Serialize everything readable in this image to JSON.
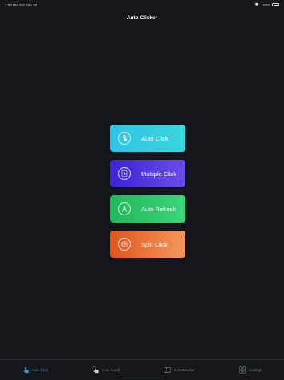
{
  "status_bar": {
    "time_date": "7:00 PM  Sat Feb 28",
    "battery_text": "100%"
  },
  "header": {
    "title": "Auto Clicker"
  },
  "actions": [
    {
      "label": "Auto Click",
      "icon": "tap-hand-icon",
      "color": "#2fc3e3"
    },
    {
      "label": "Multiple Click",
      "icon": "multi-tap-icon",
      "color": "#4a30dc"
    },
    {
      "label": "Auto Refresh",
      "icon": "letter-a-icon",
      "color": "#22bf60"
    },
    {
      "label": "Split Click",
      "icon": "grid-icon",
      "color": "#e8692e"
    }
  ],
  "tab_bar": {
    "active_color": "#2e9be8",
    "tabs": [
      {
        "label": "Auto Click",
        "icon": "hand-pointer-icon",
        "active": true
      },
      {
        "label": "Auto Scroll",
        "icon": "scroll-hand-icon",
        "active": false
      },
      {
        "label": "Auto Counter",
        "icon": "counter-icon",
        "active": false
      },
      {
        "label": "Settings",
        "icon": "grid-settings-icon",
        "active": false
      }
    ]
  }
}
